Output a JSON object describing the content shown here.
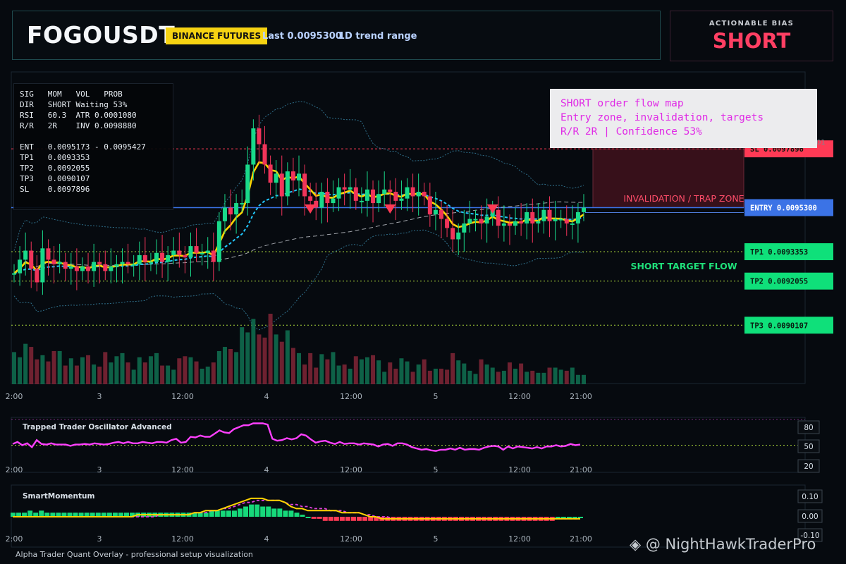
{
  "header": {
    "symbol": "FOGOUSDT",
    "exchange": "BINANCE FUTURES",
    "last": "Last 0.0095300",
    "range": "1D trend range"
  },
  "bias": {
    "title": "ACTIONABLE BIAS",
    "value": "SHORT"
  },
  "stats": {
    "line1": "SIG   MOM   VOL   PROB",
    "line2": "DIR   SHORT Waiting 53%",
    "line3": "RSI   60.3  ATR 0.0001080",
    "line4": "R/R   2R    INV 0.0098880",
    "line6": "ENT   0.0095173 - 0.0095427",
    "line7": "TP1   0.0093353",
    "line8": "TP2   0.0092055",
    "line9": "TP3   0.0090107",
    "line10": "SL    0.0097896"
  },
  "note": {
    "line1": "SHORT order flow map",
    "line2": "Entry zone, invalidation, targets",
    "line3": "R/R 2R | Confidence 53%"
  },
  "footer": "Alpha Trader Quant Overlay - professional setup visualization",
  "watermark": "◈ @ NightHawkTraderPro",
  "chart_data": [
    {
      "type": "candlestick",
      "x_ticks": [
        "2:00",
        "3",
        "12:00",
        "4",
        "12:00",
        "5",
        "12:00",
        "21:00"
      ],
      "y_range": [
        0.00875,
        0.01012
      ],
      "y_partial_tick": "01",
      "price_labels": [
        {
          "name": "SL",
          "text": "SL 0.0097896",
          "value": 0.0097896,
          "color": "#ff3a55"
        },
        {
          "name": "ENTRY",
          "text": "ENTRY 0.0095300",
          "value": 0.00953,
          "color": "#3b73e6"
        },
        {
          "name": "TP1",
          "text": "TP1 0.0093353",
          "value": 0.0093353,
          "color": "#0fe07a"
        },
        {
          "name": "TP2",
          "text": "TP2 0.0092055",
          "value": 0.0092055,
          "color": "#0fe07a"
        },
        {
          "name": "TP3",
          "text": "TP3 0.0090107",
          "value": 0.0090107,
          "color": "#0fe07a"
        }
      ],
      "zones": [
        {
          "label": "INVALIDATION / TRAP ZONE",
          "from": 0.00953,
          "to": 0.0097896,
          "color": "#ff4d6a"
        },
        {
          "label": "SHORT TARGET FLOW",
          "from": 0.0090107,
          "to": 0.00953,
          "color": "#1fe07a"
        }
      ],
      "short_signals_at_candle": [
        52,
        66,
        84
      ],
      "candles_close": [
        0.00924,
        0.0093,
        0.00934,
        0.00926,
        0.0092,
        0.00935,
        0.0093,
        0.00928,
        0.00929,
        0.00926,
        0.00927,
        0.00925,
        0.00927,
        0.00925,
        0.00929,
        0.00928,
        0.00925,
        0.00927,
        0.00928,
        0.00929,
        0.00928,
        0.00928,
        0.00932,
        0.00929,
        0.00929,
        0.00933,
        0.00929,
        0.00932,
        0.00934,
        0.00932,
        0.00931,
        0.00936,
        0.00933,
        0.00933,
        0.00934,
        0.00929,
        0.00947,
        0.00953,
        0.0095,
        0.00955,
        0.00955,
        0.00972,
        0.00988,
        0.00981,
        0.00972,
        0.00964,
        0.00968,
        0.00958,
        0.00969,
        0.00965,
        0.00968,
        0.00958,
        0.00956,
        0.00953,
        0.0096,
        0.00955,
        0.00957,
        0.00962,
        0.00961,
        0.00962,
        0.00956,
        0.00956,
        0.00961,
        0.00955,
        0.00959,
        0.00961,
        0.0096,
        0.00956,
        0.00957,
        0.00962,
        0.00958,
        0.0096,
        0.00958,
        0.0095,
        0.00952,
        0.00948,
        0.00944,
        0.00939,
        0.00942,
        0.00946,
        0.00948,
        0.00948,
        0.00946,
        0.00949,
        0.00952,
        0.00945,
        0.00946,
        0.00945,
        0.00947,
        0.00946,
        0.00951,
        0.00946,
        0.00947,
        0.00952,
        0.00947,
        0.00948,
        0.00948,
        0.00946,
        0.00946,
        0.00951,
        0.00953
      ],
      "volume_rel": [
        0.31,
        0.26,
        0.39,
        0.36,
        0.24,
        0.28,
        0.22,
        0.32,
        0.32,
        0.18,
        0.25,
        0.18,
        0.26,
        0.28,
        0.19,
        0.17,
        0.31,
        0.21,
        0.27,
        0.3,
        0.21,
        0.14,
        0.26,
        0.21,
        0.27,
        0.3,
        0.18,
        0.18,
        0.14,
        0.25,
        0.27,
        0.26,
        0.22,
        0.15,
        0.17,
        0.21,
        0.32,
        0.36,
        0.34,
        0.31,
        0.55,
        0.5,
        0.63,
        0.48,
        0.45,
        0.68,
        0.48,
        0.41,
        0.52,
        0.35,
        0.3,
        0.19,
        0.3,
        0.16,
        0.29,
        0.24,
        0.31,
        0.18,
        0.19,
        0.15,
        0.27,
        0.24,
        0.26,
        0.28,
        0.23,
        0.12,
        0.21,
        0.15,
        0.25,
        0.22,
        0.12,
        0.19,
        0.24,
        0.13,
        0.15,
        0.15,
        0.14,
        0.3,
        0.23,
        0.2,
        0.13,
        0.1,
        0.24,
        0.19,
        0.16,
        0.12,
        0.13,
        0.21,
        0.15,
        0.2,
        0.12,
        0.13,
        0.11,
        0.11,
        0.16,
        0.16,
        0.14,
        0.13,
        0.16,
        0.09,
        0.09
      ]
    },
    {
      "type": "line",
      "title": "Trapped Trader Oscillator Advanced",
      "y_ticks": [
        80,
        50,
        20
      ],
      "values": [
        52,
        55,
        50,
        53,
        47,
        58,
        52,
        51,
        53,
        51,
        51,
        51,
        49,
        51,
        51,
        52,
        51,
        53,
        52,
        51,
        52,
        54,
        55,
        53,
        55,
        53,
        53,
        55,
        54,
        53,
        55,
        55,
        54,
        58,
        60,
        54,
        55,
        63,
        62,
        65,
        63,
        63,
        68,
        73,
        70,
        69,
        75,
        78,
        81,
        81,
        84,
        84,
        84,
        82,
        60,
        57,
        58,
        61,
        59,
        61,
        67,
        65,
        59,
        54,
        56,
        57,
        54,
        52,
        55,
        52,
        53,
        53,
        51,
        53,
        52,
        51,
        48,
        51,
        52,
        49,
        53,
        53,
        51,
        47,
        45,
        43,
        44,
        42,
        41,
        43,
        43,
        45,
        43,
        46,
        43,
        44,
        44,
        43,
        46,
        48,
        49,
        48,
        43,
        48,
        45,
        48,
        47,
        46,
        45,
        47,
        45,
        48,
        48,
        50,
        48,
        49,
        52,
        50,
        51
      ]
    },
    {
      "type": "bar",
      "title": "SmartMomentum",
      "y_ticks": [
        "0.10",
        "0.00",
        "-0.10"
      ],
      "histogram": [
        0.02,
        0.02,
        0.02,
        0.03,
        0.02,
        0.03,
        0.02,
        0.02,
        0.02,
        0.02,
        0.02,
        0.02,
        0.02,
        0.02,
        0.02,
        0.02,
        0.02,
        0.02,
        0.02,
        0.02,
        0.02,
        0.02,
        0.02,
        0.02,
        0.02,
        0.02,
        0.02,
        0.02,
        0.02,
        0.02,
        0.02,
        0.02,
        0.02,
        0.02,
        0.02,
        0.03,
        0.03,
        0.03,
        0.03,
        0.03,
        0.04,
        0.05,
        0.06,
        0.06,
        0.05,
        0.05,
        0.04,
        0.04,
        0.03,
        0.03,
        0.02,
        0.01,
        0.0,
        -0.01,
        -0.01,
        -0.02,
        -0.02,
        -0.02,
        -0.02,
        -0.02,
        -0.02,
        -0.02,
        -0.02,
        -0.02,
        -0.02,
        -0.02,
        -0.02,
        -0.02,
        -0.02,
        -0.02,
        -0.02,
        -0.02,
        -0.02,
        -0.02,
        -0.02,
        -0.02,
        -0.02,
        -0.02,
        -0.02,
        -0.02,
        -0.02,
        -0.02,
        -0.02,
        -0.02,
        -0.02,
        -0.02,
        -0.02,
        -0.02,
        -0.02,
        -0.02,
        -0.02,
        -0.02,
        -0.02,
        -0.02,
        -0.02,
        -0.02,
        0.0,
        0.0,
        0.0,
        0.0,
        0.0
      ],
      "line": [
        0.0,
        0.0,
        0.0,
        0.0,
        0.0,
        0.0,
        0.0,
        0.0,
        0.0,
        0.0,
        0.0,
        0.0,
        0.0,
        0.0,
        0.0,
        0.0,
        0.0,
        0.0,
        0.0,
        0.0,
        0.0,
        0.0,
        0.01,
        0.01,
        0.01,
        0.01,
        0.01,
        0.01,
        0.01,
        0.01,
        0.01,
        0.01,
        0.02,
        0.02,
        0.03,
        0.03,
        0.03,
        0.04,
        0.05,
        0.06,
        0.07,
        0.08,
        0.09,
        0.09,
        0.09,
        0.08,
        0.08,
        0.08,
        0.07,
        0.05,
        0.04,
        0.04,
        0.03,
        0.03,
        0.03,
        0.03,
        0.03,
        0.03,
        0.02,
        0.02,
        0.02,
        0.02,
        0.01,
        0.0,
        0.0,
        -0.01,
        -0.01,
        -0.01,
        -0.01,
        -0.01,
        -0.01,
        -0.01,
        -0.01,
        -0.01,
        -0.01,
        -0.01,
        -0.01,
        -0.01,
        -0.01,
        -0.01,
        -0.01,
        -0.01,
        -0.01,
        -0.01,
        -0.01,
        -0.01,
        -0.01,
        -0.01,
        -0.01,
        -0.01,
        -0.01,
        -0.01,
        -0.01,
        -0.01,
        -0.01,
        -0.01,
        -0.01,
        -0.01,
        -0.01,
        -0.01,
        -0.01
      ],
      "signal_dashed": [
        0.0,
        0.0,
        0.0,
        0.0,
        0.0,
        0.0,
        0.0,
        0.0,
        0.0,
        0.0,
        0.0,
        0.0,
        0.0,
        0.0,
        0.0,
        0.0,
        0.0,
        0.0,
        0.0,
        0.0,
        0.0,
        0.0,
        0.0,
        0.0,
        0.0,
        0.0,
        0.01,
        0.01,
        0.01,
        0.01,
        0.01,
        0.01,
        0.02,
        0.02,
        0.02,
        0.03,
        0.03,
        0.04,
        0.04,
        0.05,
        0.06,
        0.07,
        0.07,
        0.08,
        0.08,
        0.08,
        0.08,
        0.08,
        0.07,
        0.06,
        0.06,
        0.05,
        0.05,
        0.04,
        0.04,
        0.04,
        0.03,
        0.03,
        0.03,
        0.02,
        0.02,
        0.02,
        0.01,
        0.01,
        0.0,
        0.0,
        0.0,
        -0.01,
        -0.01,
        -0.01,
        -0.01,
        -0.01,
        -0.01,
        -0.01,
        -0.01,
        -0.01,
        -0.01,
        -0.01,
        -0.01,
        -0.01,
        -0.01,
        -0.01,
        -0.01,
        -0.01,
        -0.01,
        -0.01,
        -0.01,
        -0.01,
        -0.01,
        -0.01,
        -0.01,
        -0.01,
        -0.01,
        -0.01,
        -0.01,
        -0.01,
        -0.01,
        -0.01,
        -0.01,
        -0.01,
        -0.01
      ]
    }
  ]
}
